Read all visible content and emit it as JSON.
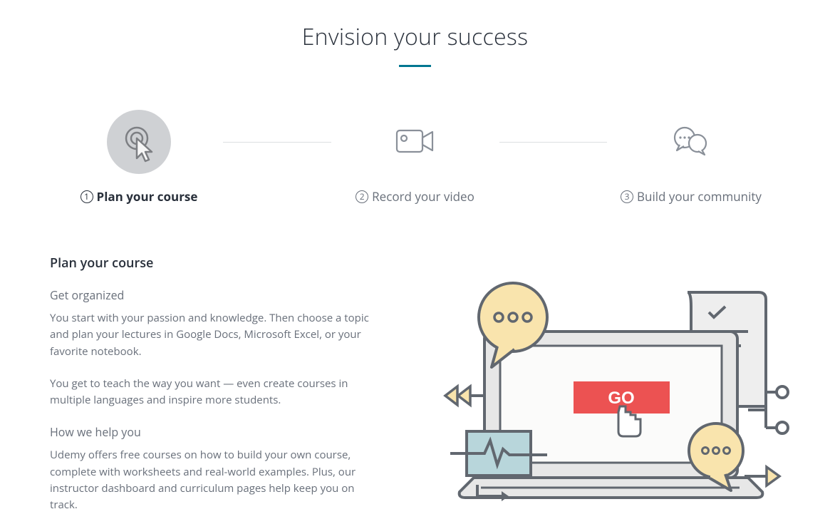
{
  "header": {
    "title": "Envision your success"
  },
  "steps": [
    {
      "num": "1",
      "label": "Plan your course",
      "active": true
    },
    {
      "num": "2",
      "label": "Record your video",
      "active": false
    },
    {
      "num": "3",
      "label": "Build your community",
      "active": false
    }
  ],
  "detail": {
    "heading": "Plan your course",
    "sub1": "Get organized",
    "para1": "You start with your passion and knowledge. Then choose a topic and plan your lectures in Google Docs, Microsoft Excel, or your favorite notebook.",
    "para2": "You get to teach the way you want — even create courses in multiple languages and inspire more students.",
    "sub2": "How we help you",
    "para3": "Udemy offers free courses on how to build your own course, complete with worksheets and real-world examples. Plus, our instructor dashboard and curriculum pages help keep you on track."
  },
  "illustration": {
    "go_label": "GO"
  }
}
